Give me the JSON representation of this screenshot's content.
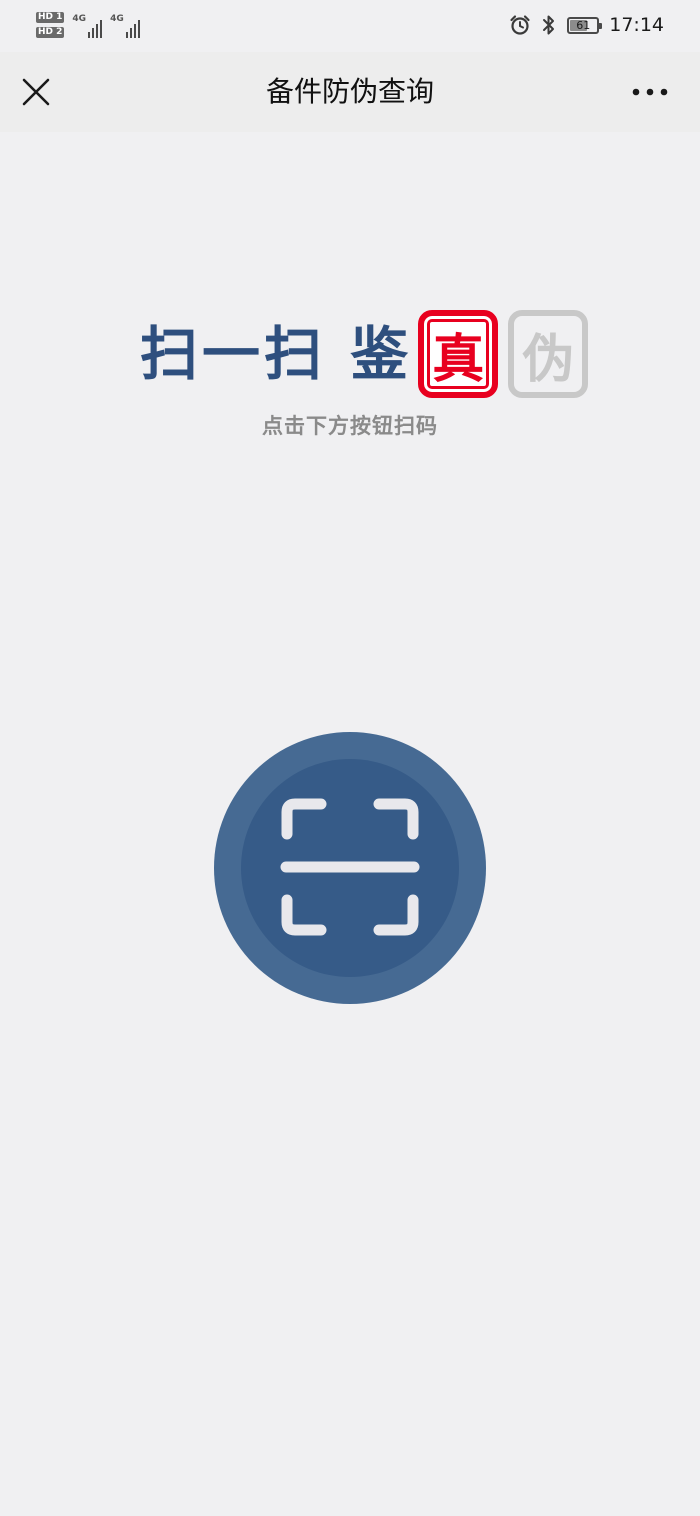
{
  "status_bar": {
    "sim1_badge": "HD 1",
    "sim2_badge": "HD 2",
    "net1_label": "4G",
    "net2_label": "4G",
    "battery_level": "61",
    "time": "17:14",
    "icons": [
      "alarm-icon",
      "bluetooth-icon",
      "battery-icon"
    ]
  },
  "nav": {
    "close_icon": "close-icon",
    "title": "备件防伪查询",
    "more_icon": "more-icon"
  },
  "hero": {
    "text": "扫一扫 鉴",
    "tag_real": "真",
    "tag_fake": "伪",
    "colors": {
      "headline": "#2e4f7e",
      "real": "#e8001f",
      "fake": "#c8c8c8"
    }
  },
  "hint": "点击下方按钮扫码",
  "scan_button": {
    "icon": "scan-icon",
    "colors": {
      "outer": "#466a93",
      "inner": "#365b88",
      "glyph": "#e8e8ec"
    }
  }
}
